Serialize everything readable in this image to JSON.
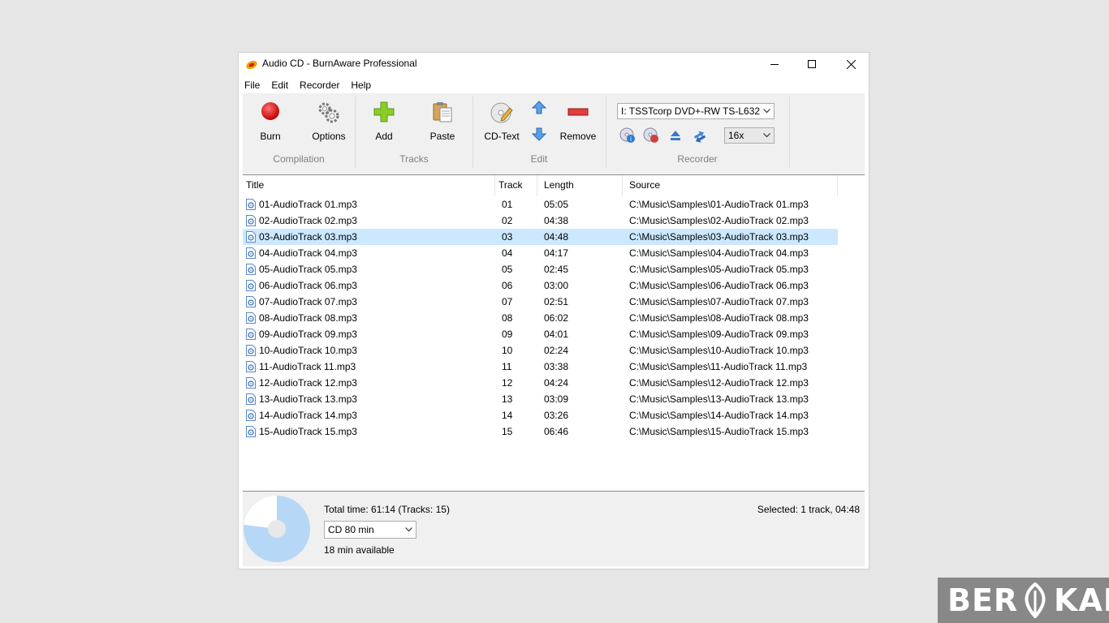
{
  "window": {
    "title": "Audio CD - BurnAware Professional"
  },
  "menu": {
    "items": [
      "File",
      "Edit",
      "Recorder",
      "Help"
    ]
  },
  "ribbon": {
    "compilation": {
      "label": "Compilation",
      "burn": "Burn",
      "options": "Options"
    },
    "tracks": {
      "label": "Tracks",
      "add": "Add",
      "paste": "Paste"
    },
    "edit": {
      "label": "Edit",
      "cdtext": "CD-Text",
      "remove": "Remove"
    },
    "recorder": {
      "label": "Recorder",
      "drive": "I: TSSTcorp DVD+-RW TS-L632",
      "speed": "16x"
    }
  },
  "list": {
    "columns": {
      "title": "Title",
      "track": "Track",
      "length": "Length",
      "source": "Source"
    },
    "selected_index": 2,
    "rows": [
      {
        "title": "01-AudioTrack 01.mp3",
        "track": "01",
        "length": "05:05",
        "source": "C:\\Music\\Samples\\01-AudioTrack 01.mp3"
      },
      {
        "title": "02-AudioTrack 02.mp3",
        "track": "02",
        "length": "04:38",
        "source": "C:\\Music\\Samples\\02-AudioTrack 02.mp3"
      },
      {
        "title": "03-AudioTrack 03.mp3",
        "track": "03",
        "length": "04:48",
        "source": "C:\\Music\\Samples\\03-AudioTrack 03.mp3"
      },
      {
        "title": "04-AudioTrack 04.mp3",
        "track": "04",
        "length": "04:17",
        "source": "C:\\Music\\Samples\\04-AudioTrack 04.mp3"
      },
      {
        "title": "05-AudioTrack 05.mp3",
        "track": "05",
        "length": "02:45",
        "source": "C:\\Music\\Samples\\05-AudioTrack 05.mp3"
      },
      {
        "title": "06-AudioTrack 06.mp3",
        "track": "06",
        "length": "03:00",
        "source": "C:\\Music\\Samples\\06-AudioTrack 06.mp3"
      },
      {
        "title": "07-AudioTrack 07.mp3",
        "track": "07",
        "length": "02:51",
        "source": "C:\\Music\\Samples\\07-AudioTrack 07.mp3"
      },
      {
        "title": "08-AudioTrack 08.mp3",
        "track": "08",
        "length": "06:02",
        "source": "C:\\Music\\Samples\\08-AudioTrack 08.mp3"
      },
      {
        "title": "09-AudioTrack 09.mp3",
        "track": "09",
        "length": "04:01",
        "source": "C:\\Music\\Samples\\09-AudioTrack 09.mp3"
      },
      {
        "title": "10-AudioTrack 10.mp3",
        "track": "10",
        "length": "02:24",
        "source": "C:\\Music\\Samples\\10-AudioTrack 10.mp3"
      },
      {
        "title": "11-AudioTrack 11.mp3",
        "track": "11",
        "length": "03:38",
        "source": "C:\\Music\\Samples\\11-AudioTrack 11.mp3"
      },
      {
        "title": "12-AudioTrack 12.mp3",
        "track": "12",
        "length": "04:24",
        "source": "C:\\Music\\Samples\\12-AudioTrack 12.mp3"
      },
      {
        "title": "13-AudioTrack 13.mp3",
        "track": "13",
        "length": "03:09",
        "source": "C:\\Music\\Samples\\13-AudioTrack 13.mp3"
      },
      {
        "title": "14-AudioTrack 14.mp3",
        "track": "14",
        "length": "03:26",
        "source": "C:\\Music\\Samples\\14-AudioTrack 14.mp3"
      },
      {
        "title": "15-AudioTrack 15.mp3",
        "track": "15",
        "length": "06:46",
        "source": "C:\\Music\\Samples\\15-AudioTrack 15.mp3"
      }
    ]
  },
  "status": {
    "total_time": "Total time: 61:14 (Tracks: 15)",
    "disc_type": "CD 80 min",
    "available": "18 min available",
    "selected": "Selected: 1 track, 04:48",
    "disc_used_fraction": 0.77
  },
  "colors": {
    "selection": "#cce8ff",
    "disc_used": "#b7d7f7",
    "burn": "#e02020"
  },
  "watermark": {
    "text_a": "BER",
    "text_b": "KAL"
  }
}
